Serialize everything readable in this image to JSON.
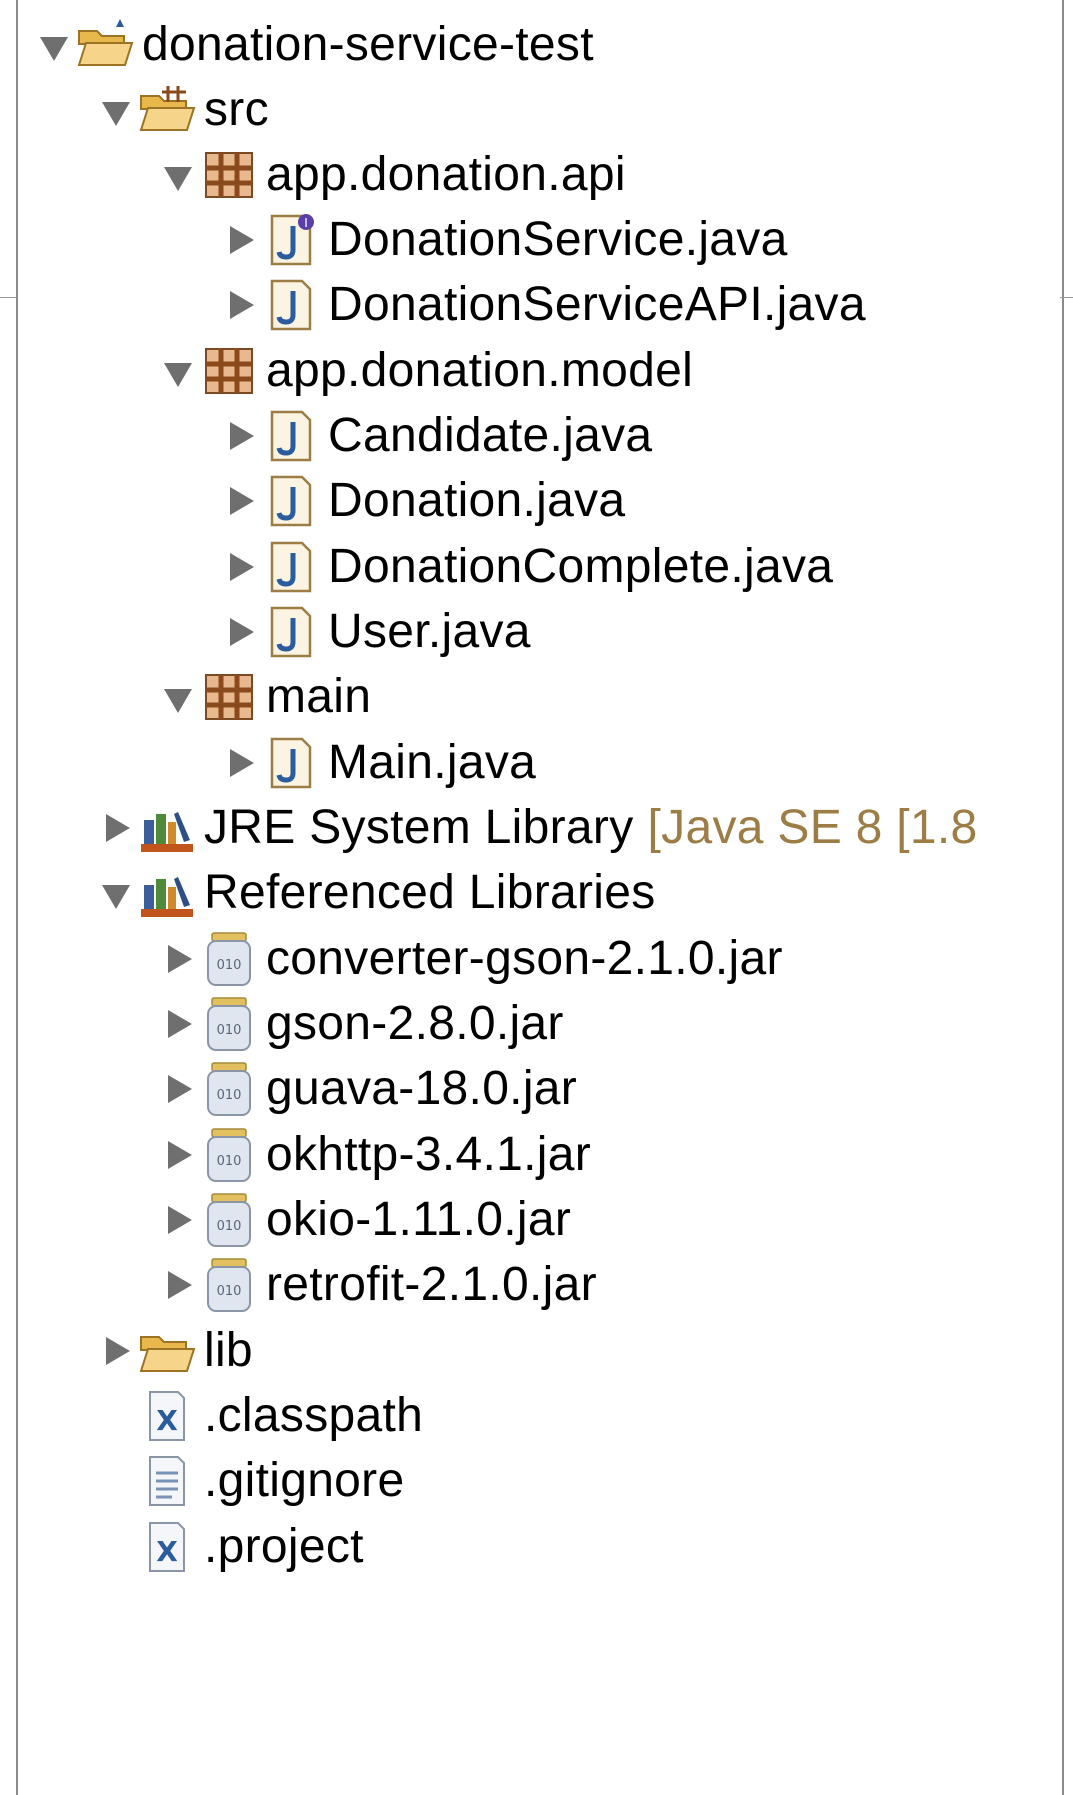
{
  "tree": {
    "project": {
      "label": "donation-service-test",
      "icon": "project-folder-icon"
    },
    "src": {
      "label": "src",
      "icon": "source-folder-icon"
    },
    "pkg_api": {
      "label": "app.donation.api",
      "icon": "package-icon",
      "files": [
        {
          "label": "DonationService.java",
          "icon": "java-interface-icon"
        },
        {
          "label": "DonationServiceAPI.java",
          "icon": "java-file-icon"
        }
      ]
    },
    "pkg_model": {
      "label": "app.donation.model",
      "icon": "package-icon",
      "files": [
        {
          "label": "Candidate.java",
          "icon": "java-file-icon"
        },
        {
          "label": "Donation.java",
          "icon": "java-file-icon"
        },
        {
          "label": "DonationComplete.java",
          "icon": "java-file-icon"
        },
        {
          "label": "User.java",
          "icon": "java-file-icon"
        }
      ]
    },
    "pkg_main": {
      "label": "main",
      "icon": "package-icon",
      "files": [
        {
          "label": "Main.java",
          "icon": "java-file-icon"
        }
      ]
    },
    "jre": {
      "label": "JRE System Library",
      "decoration": "[Java SE 8 [1.8",
      "icon": "library-icon"
    },
    "reflibs": {
      "label": "Referenced Libraries",
      "icon": "library-icon",
      "jars": [
        {
          "label": "converter-gson-2.1.0.jar",
          "icon": "jar-icon"
        },
        {
          "label": "gson-2.8.0.jar",
          "icon": "jar-icon"
        },
        {
          "label": "guava-18.0.jar",
          "icon": "jar-icon"
        },
        {
          "label": "okhttp-3.4.1.jar",
          "icon": "jar-icon"
        },
        {
          "label": "okio-1.11.0.jar",
          "icon": "jar-icon"
        },
        {
          "label": "retrofit-2.1.0.jar",
          "icon": "jar-icon"
        }
      ]
    },
    "lib": {
      "label": "lib",
      "icon": "folder-icon"
    },
    "files": [
      {
        "label": ".classpath",
        "icon": "xml-file-icon"
      },
      {
        "label": ".gitignore",
        "icon": "text-file-icon"
      },
      {
        "label": ".project",
        "icon": "xml-file-icon"
      }
    ]
  },
  "colors": {
    "decoration": "#9c7d45",
    "twisty": "#6f6f6f",
    "border": "#8a8a8a"
  }
}
